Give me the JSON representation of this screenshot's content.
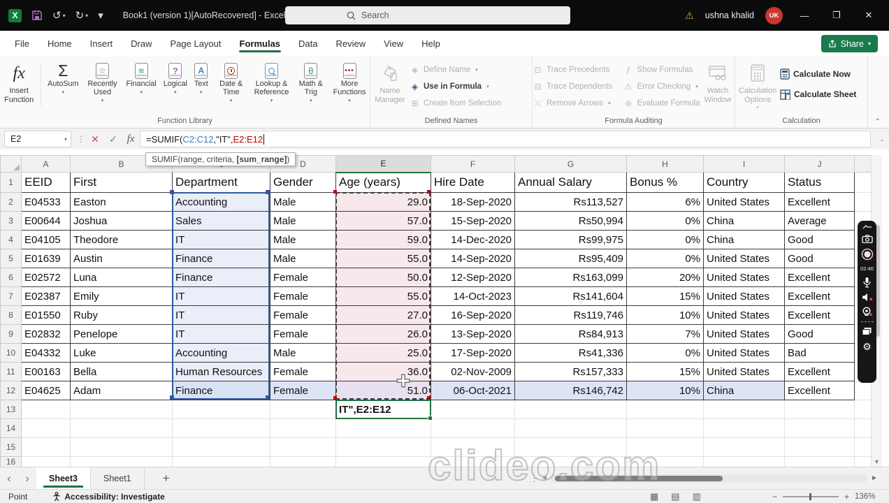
{
  "title_bar": {
    "title": "Book1 (version 1)[AutoRecovered] - Excel",
    "search_placeholder": "Search",
    "user_name": "ushna khalid",
    "avatar_initials": "UK"
  },
  "ribbon_tabs": {
    "items": [
      {
        "label": "File"
      },
      {
        "label": "Home"
      },
      {
        "label": "Insert"
      },
      {
        "label": "Draw"
      },
      {
        "label": "Page Layout"
      },
      {
        "label": "Formulas",
        "active": true
      },
      {
        "label": "Data"
      },
      {
        "label": "Review"
      },
      {
        "label": "View"
      },
      {
        "label": "Help"
      }
    ],
    "share_label": "Share"
  },
  "ribbon": {
    "function_library": {
      "label": "Function Library",
      "insert_function": "Insert Function",
      "buttons": [
        {
          "label": "AutoSum"
        },
        {
          "label": "Recently Used"
        },
        {
          "label": "Financial"
        },
        {
          "label": "Logical"
        },
        {
          "label": "Text"
        },
        {
          "label": "Date & Time"
        },
        {
          "label": "Lookup & Reference"
        },
        {
          "label": "Math & Trig"
        },
        {
          "label": "More Functions"
        }
      ]
    },
    "defined_names": {
      "label": "Defined Names",
      "name_manager": "Name Manager",
      "items": [
        {
          "label": "Define Name",
          "enabled": false
        },
        {
          "label": "Use in Formula",
          "enabled": true
        },
        {
          "label": "Create from Selection",
          "enabled": false
        }
      ]
    },
    "formula_auditing": {
      "label": "Formula Auditing",
      "col1": [
        {
          "label": "Trace Precedents",
          "enabled": false
        },
        {
          "label": "Trace Dependents",
          "enabled": false
        },
        {
          "label": "Remove Arrows",
          "enabled": false
        }
      ],
      "col2": [
        {
          "label": "Show Formulas",
          "enabled": false
        },
        {
          "label": "Error Checking",
          "enabled": false
        },
        {
          "label": "Evaluate Formula",
          "enabled": false
        }
      ],
      "watch_window": "Watch Window"
    },
    "calculation": {
      "label": "Calculation",
      "options": "Calculation Options",
      "calculate_now": "Calculate Now",
      "calculate_sheet": "Calculate Sheet"
    }
  },
  "formula_bar": {
    "name_box": "E2",
    "parts": [
      {
        "text": "=SUMIF(",
        "color": "#1a1a1a"
      },
      {
        "text": "C2:C12",
        "color": "#4472c4"
      },
      {
        "text": ",",
        "color": "#1a1a1a"
      },
      {
        "text": "\"IT\"",
        "color": "#1a1a1a"
      },
      {
        "text": ",",
        "color": "#1a1a1a"
      },
      {
        "text": "E2:E12",
        "color": "#c00000"
      }
    ],
    "tooltip": {
      "prefix": "SUMIF(range, criteria, ",
      "bold": "[sum_range]",
      "suffix": ")"
    }
  },
  "grid": {
    "column_letters": [
      "A",
      "B",
      "C",
      "D",
      "E",
      "F",
      "G",
      "H",
      "I",
      "J",
      ""
    ],
    "active_column": "E",
    "headers": [
      "EEID",
      "First",
      "Department",
      "Gender",
      "Age (years)",
      "Hire Date",
      "Annual Salary",
      "Bonus %",
      "Country",
      "Status"
    ],
    "columns": [
      {
        "key": "eeid",
        "align": "left"
      },
      {
        "key": "first",
        "align": "left"
      },
      {
        "key": "dept",
        "align": "left"
      },
      {
        "key": "gender",
        "align": "left"
      },
      {
        "key": "age",
        "align": "right"
      },
      {
        "key": "hire",
        "align": "right"
      },
      {
        "key": "salary",
        "align": "right"
      },
      {
        "key": "bonus",
        "align": "right"
      },
      {
        "key": "country",
        "align": "left"
      },
      {
        "key": "status",
        "align": "left"
      }
    ],
    "highlight_keys": [
      "dept",
      "gender",
      "age",
      "hire",
      "salary",
      "bonus",
      "country"
    ],
    "rows": [
      {
        "n": 2,
        "eeid": "E04533",
        "first": "Easton",
        "dept": "Accounting",
        "gender": "Male",
        "age": "29.0",
        "hire": "18-Sep-2020",
        "salary": "Rs113,527",
        "bonus": "6%",
        "country": "United States",
        "status": "Excellent",
        "eeid_bold": true,
        "row_highlight": false
      },
      {
        "n": 3,
        "eeid": "E00644",
        "first": "Joshua",
        "dept": "Sales",
        "gender": "Male",
        "age": "57.0",
        "hire": "15-Sep-2020",
        "salary": "Rs50,994",
        "bonus": "0%",
        "country": "China",
        "status": "Average",
        "eeid_bold": true,
        "row_highlight": false
      },
      {
        "n": 4,
        "eeid": "E04105",
        "first": "Theodore",
        "dept": "IT",
        "gender": "Male",
        "age": "59.0",
        "hire": "14-Dec-2020",
        "salary": "Rs99,975",
        "bonus": "0%",
        "country": "China",
        "status": "Good",
        "eeid_bold": true,
        "row_highlight": false
      },
      {
        "n": 5,
        "eeid": "E01639",
        "first": "Austin",
        "dept": "Finance",
        "gender": "Male",
        "age": "55.0",
        "hire": "14-Sep-2020",
        "salary": "Rs95,409",
        "bonus": "0%",
        "country": "United States",
        "status": "Good",
        "eeid_bold": true,
        "row_highlight": false
      },
      {
        "n": 6,
        "eeid": "E02572",
        "first": "Luna",
        "dept": "Finance",
        "gender": "Female",
        "age": "50.0",
        "hire": "12-Sep-2020",
        "salary": "Rs163,099",
        "bonus": "20%",
        "country": "United States",
        "status": "Excellent",
        "eeid_bold": true,
        "row_highlight": false
      },
      {
        "n": 7,
        "eeid": "E02387",
        "first": "Emily",
        "dept": "IT",
        "gender": "Female",
        "age": "55.0",
        "hire": "14-Oct-2023",
        "salary": "Rs141,604",
        "bonus": "15%",
        "country": "United States",
        "status": "Excellent",
        "eeid_bold": true,
        "row_highlight": false
      },
      {
        "n": 8,
        "eeid": "E01550",
        "first": "Ruby",
        "dept": "IT",
        "gender": "Female",
        "age": "27.0",
        "hire": "16-Sep-2020",
        "salary": "Rs119,746",
        "bonus": "10%",
        "country": "United States",
        "status": "Excellent",
        "eeid_bold": true,
        "row_highlight": false
      },
      {
        "n": 9,
        "eeid": "E02832",
        "first": "Penelope",
        "dept": "IT",
        "gender": "Female",
        "age": "26.0",
        "hire": "13-Sep-2020",
        "salary": "Rs84,913",
        "bonus": "7%",
        "country": "United States",
        "status": "Good",
        "eeid_bold": true,
        "row_highlight": false
      },
      {
        "n": 10,
        "eeid": "E04332",
        "first": "Luke",
        "dept": "Accounting",
        "gender": "Male",
        "age": "25.0",
        "hire": "17-Sep-2020",
        "salary": "Rs41,336",
        "bonus": "0%",
        "country": "United States",
        "status": "Bad",
        "eeid_bold": true,
        "row_highlight": false
      },
      {
        "n": 11,
        "eeid": "E00163",
        "first": "Bella",
        "dept": "Human Resources",
        "gender": "Female",
        "age": "36.0",
        "hire": "02-Nov-2009",
        "salary": "Rs157,333",
        "bonus": "15%",
        "country": "United States",
        "status": "Excellent",
        "eeid_bold": false,
        "row_highlight": false
      },
      {
        "n": 12,
        "eeid": "E04625",
        "first": "Adam",
        "dept": "Finance",
        "gender": "Female",
        "age": "51.0",
        "hire": "06-Oct-2021",
        "salary": "Rs146,742",
        "bonus": "10%",
        "country": "China",
        "status": "Excellent",
        "eeid_bold": false,
        "row_highlight": true
      }
    ],
    "empty_row_numbers": [
      13,
      14,
      15,
      16
    ],
    "edit_cell_text": "IT\",E2:E12"
  },
  "sheet_bar": {
    "tabs": [
      {
        "label": "Sheet3",
        "active": true
      },
      {
        "label": "Sheet1",
        "active": false
      }
    ],
    "add_label": "+"
  },
  "status_bar": {
    "mode": "Point",
    "accessibility": "Accessibility: Investigate",
    "zoom": "136%"
  },
  "recorder": {
    "time": "02:40"
  },
  "watermark": "clideo.com",
  "colors": {
    "accent_green": "#217346",
    "selection_blue": "#2f5b9e",
    "range_red": "#c00000",
    "pink_fill": "#f7e8ec",
    "blue_fill": "#e9eef9",
    "row_highlight": "#dce4f5",
    "share_green": "#1a7a4c",
    "avatar_red": "#c9362f",
    "disabled": "#ababab",
    "titlebar_black": "#0b0b0b"
  }
}
